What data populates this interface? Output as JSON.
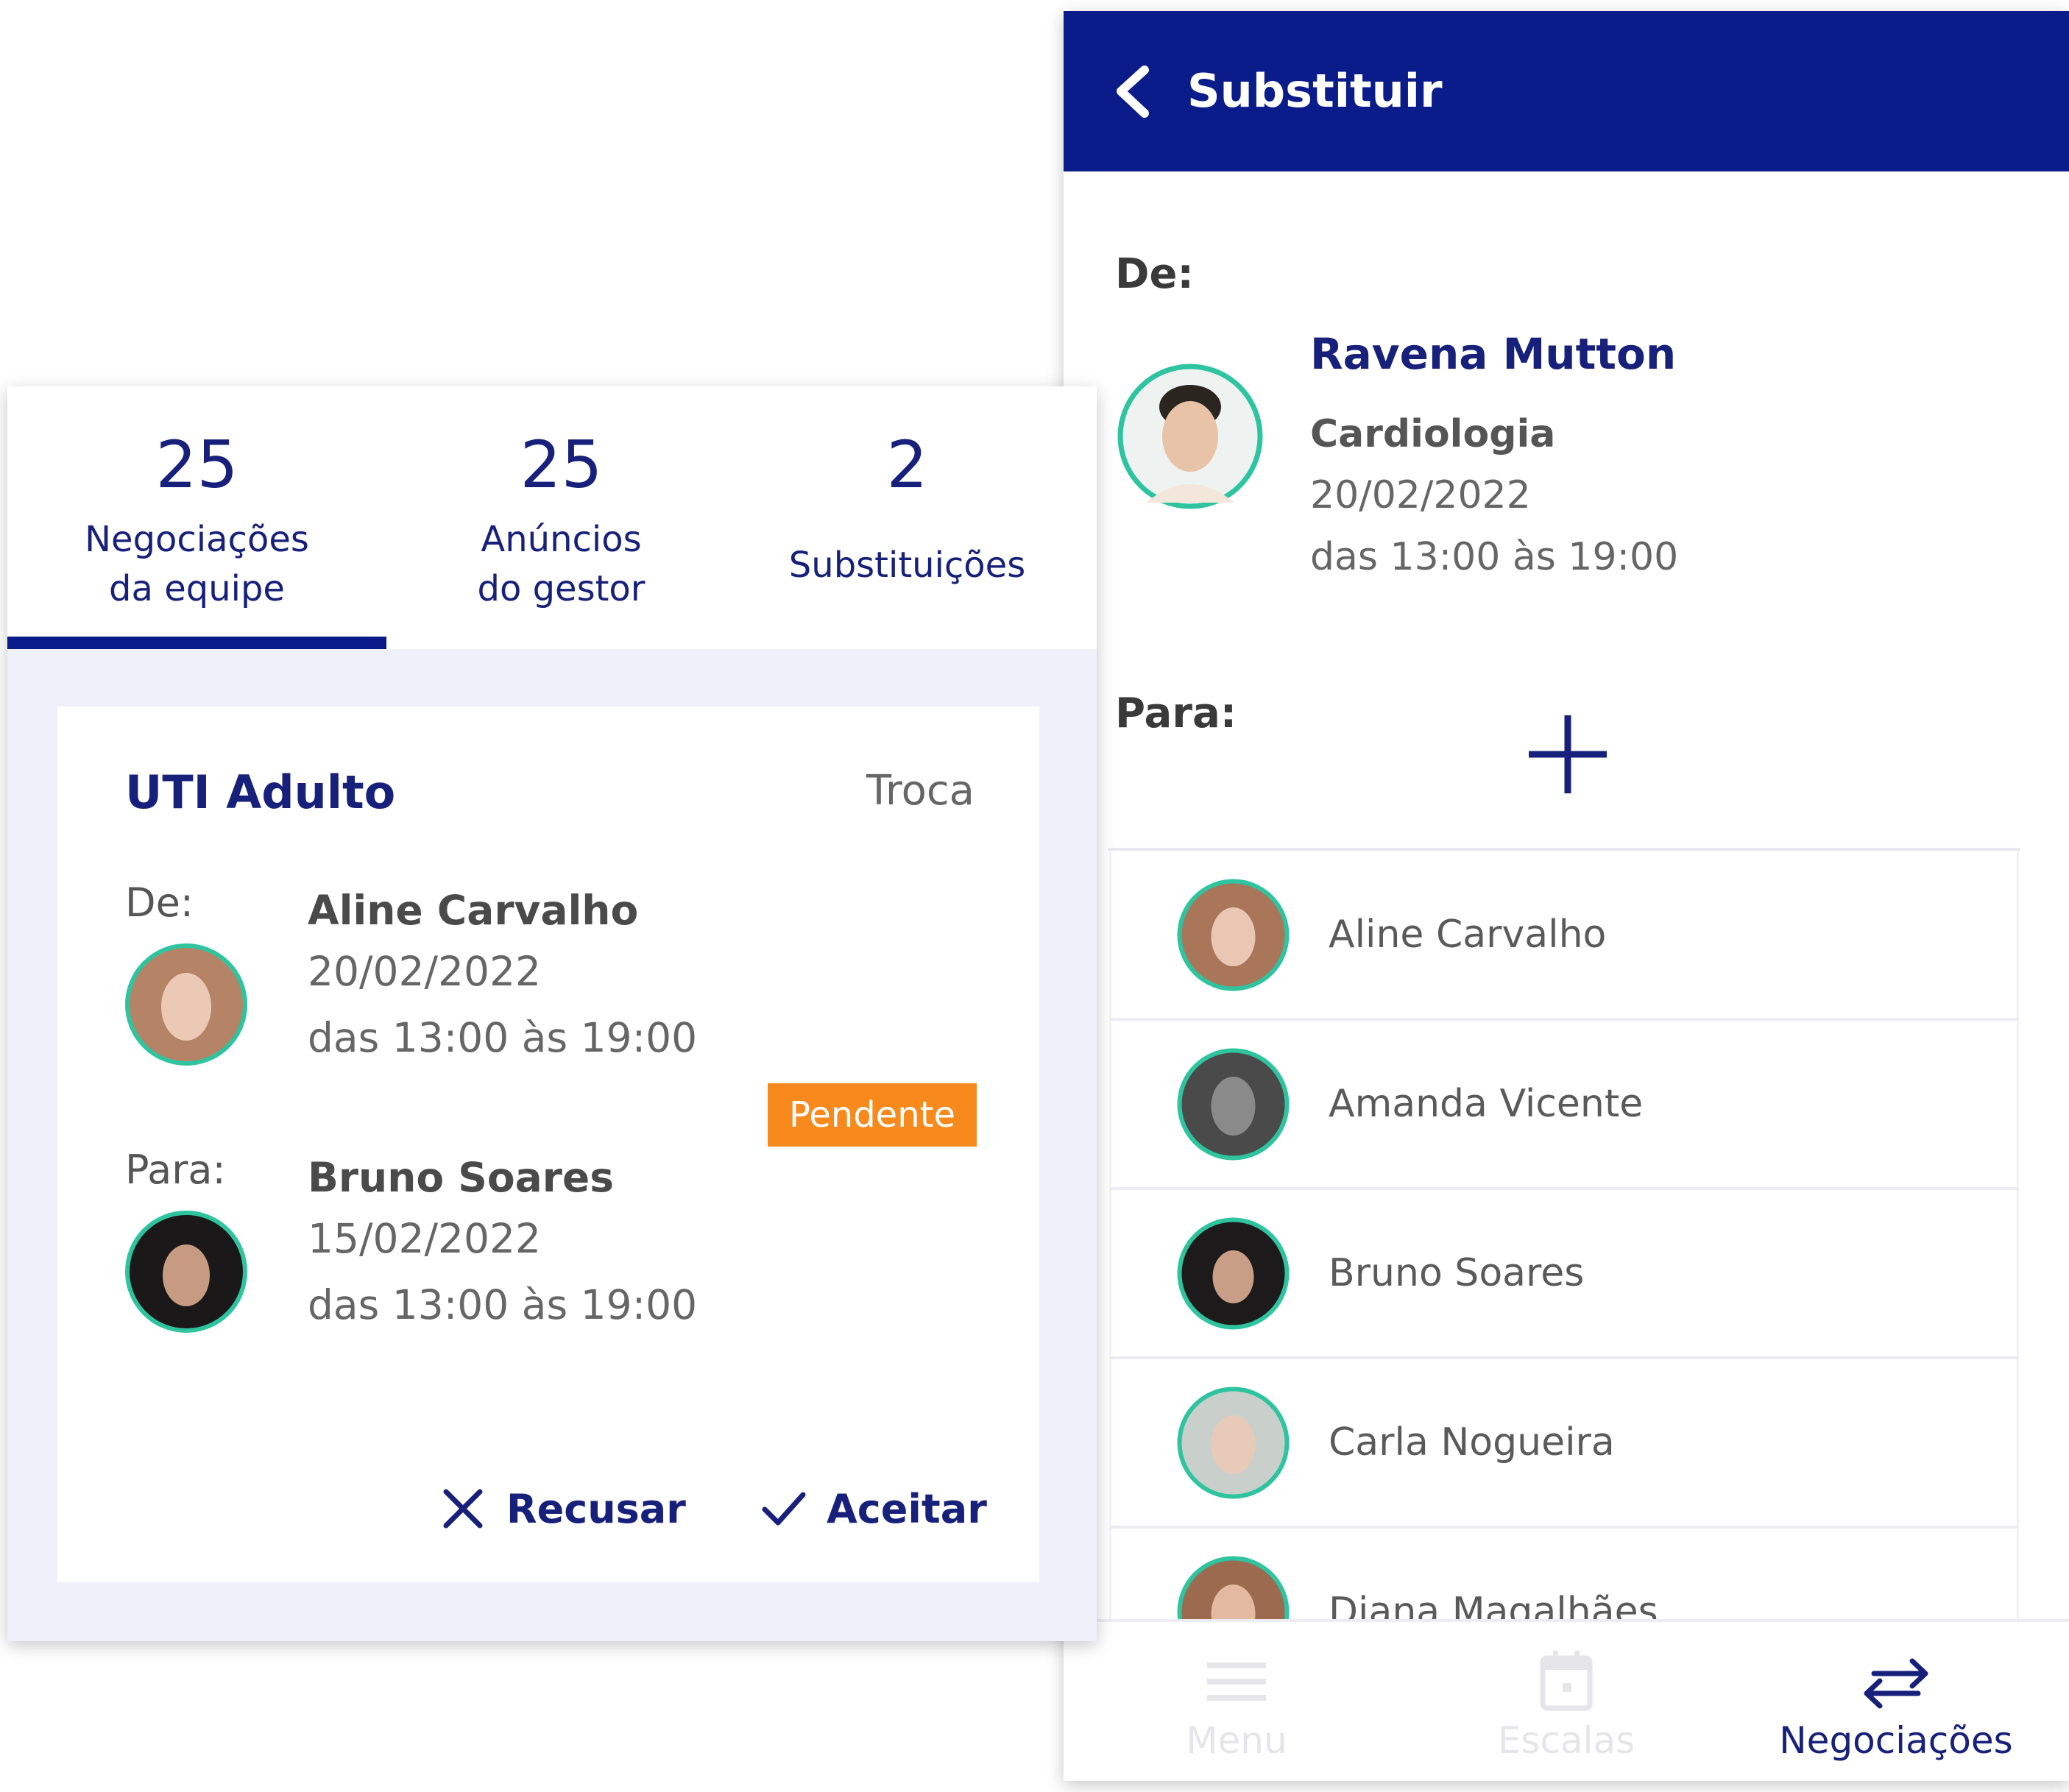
{
  "substituir_screen": {
    "title": "Substituir",
    "from_label": "De:",
    "from": {
      "name": "Ravena Mutton",
      "specialty": "Cardiologia",
      "date": "20/02/2022",
      "time": "das 13:00 às 19:00"
    },
    "to_label": "Para:",
    "people": [
      {
        "name": "Aline Carvalho"
      },
      {
        "name": "Amanda Vicente"
      },
      {
        "name": "Bruno Soares"
      },
      {
        "name": "Carla Nogueira"
      },
      {
        "name": "Diana Magalhães"
      }
    ],
    "nav": [
      {
        "label": "Menu",
        "icon": "menu-icon"
      },
      {
        "label": "Escalas",
        "icon": "calendar-icon"
      },
      {
        "label": "Negociações",
        "icon": "swap-arrows-icon"
      }
    ]
  },
  "negociacoes_screen": {
    "tabs": [
      {
        "count": "25",
        "line1": "Negociações",
        "line2": "da equipe"
      },
      {
        "count": "25",
        "line1": "Anúncios",
        "line2": "do gestor"
      },
      {
        "count": "2",
        "line1": "Substituições"
      }
    ],
    "card": {
      "title": "UTI Adulto",
      "type": "Troca",
      "from_label": "De:",
      "from": {
        "name": "Aline Carvalho",
        "date": "20/02/2022",
        "time": "das 13:00 às 19:00"
      },
      "status": "Pendente",
      "to_label": "Para:",
      "to": {
        "name": "Bruno Soares",
        "date": "15/02/2022",
        "time": "das 13:00 às 19:00"
      },
      "decline_label": "Recusar",
      "accept_label": "Aceitar"
    }
  },
  "colors": {
    "primary": "#0a1b8a",
    "accent_text": "#17207a",
    "avatar_ring": "#2ec4a0",
    "pending": "#f7891d"
  }
}
